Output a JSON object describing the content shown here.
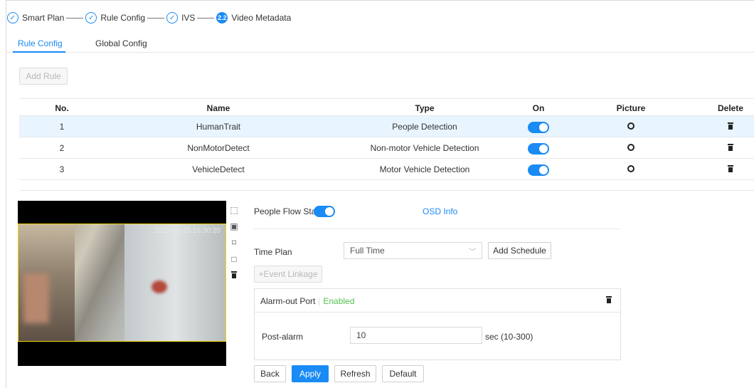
{
  "stepper": {
    "steps": [
      {
        "label": "Smart Plan",
        "state": "done"
      },
      {
        "label": "Rule Config",
        "state": "done"
      },
      {
        "label": "IVS",
        "state": "done"
      },
      {
        "label": "Video Metadata",
        "state": "active",
        "badge": "2.2"
      }
    ]
  },
  "tabs": [
    {
      "label": "Rule Config",
      "active": true
    },
    {
      "label": "Global Config",
      "active": false
    }
  ],
  "add_rule_label": "Add Rule",
  "table": {
    "headers": {
      "no": "No.",
      "name": "Name",
      "type": "Type",
      "on": "On",
      "picture": "Picture",
      "delete": "Delete"
    },
    "rows": [
      {
        "no": "1",
        "name": "HumanTrait",
        "type": "People Detection",
        "on": true,
        "selected": true
      },
      {
        "no": "2",
        "name": "NonMotorDetect",
        "type": "Non-motor Vehicle Detection",
        "on": true,
        "selected": false
      },
      {
        "no": "3",
        "name": "VehicleDetect",
        "type": "Motor Vehicle Detection",
        "on": true,
        "selected": false
      }
    ]
  },
  "video": {
    "timestamp": "2023-05-25 16:30:20"
  },
  "panel": {
    "people_flow_label": "People Flow Stat...",
    "people_flow_on": true,
    "osd_info": "OSD Info",
    "time_plan_label": "Time Plan",
    "time_plan_value": "Full Time",
    "add_schedule": "Add Schedule",
    "event_linkage": "+Event Linkage",
    "alarm_out_label": "Alarm-out Port",
    "alarm_out_status": "Enabled",
    "post_alarm_label": "Post-alarm",
    "post_alarm_value": "10",
    "post_alarm_unit": "sec (10-300)"
  },
  "footer": {
    "back": "Back",
    "apply": "Apply",
    "refresh": "Refresh",
    "default": "Default"
  },
  "colors": {
    "accent": "#1a8bf5",
    "enabled": "#53c24e",
    "selected_row": "#e8f4fe"
  }
}
